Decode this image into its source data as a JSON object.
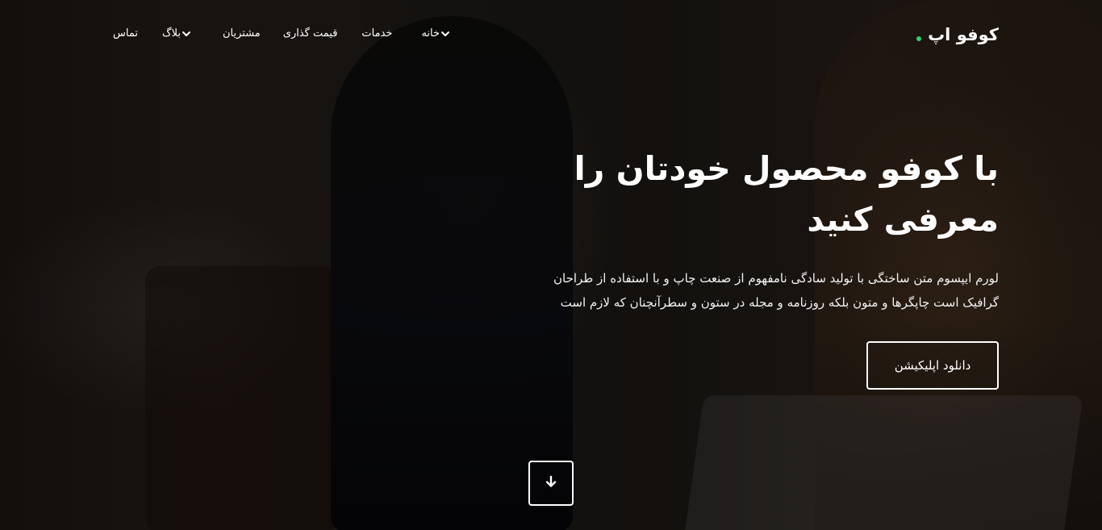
{
  "brand": {
    "name": "کوفو اپ",
    "dot_color": "#2bd46d"
  },
  "nav": {
    "items": [
      {
        "label": "خانه",
        "dropdown": true
      },
      {
        "label": "خدمات",
        "dropdown": false
      },
      {
        "label": "قیمت گذاری",
        "dropdown": false
      },
      {
        "label": "مشتریان",
        "dropdown": false
      },
      {
        "label": "بلاگ",
        "dropdown": true
      },
      {
        "label": "تماس",
        "dropdown": false
      }
    ]
  },
  "hero": {
    "headline": "با کوفو محصول خودتان را معرفی کنید",
    "lead": "لورم ایپسوم متن ساختگی با تولید سادگی نامفهوم از صنعت چاپ و با استفاده از طراحان گرافیک است چاپگرها و متون بلکه روزنامه و مجله در ستون و سطرآنچنان که لازم است",
    "cta_label": "دانلود اپلیکیشن",
    "scroll_icon": "arrow-down-icon"
  },
  "colors": {
    "text": "#ffffff",
    "accent": "#2bd46d"
  }
}
